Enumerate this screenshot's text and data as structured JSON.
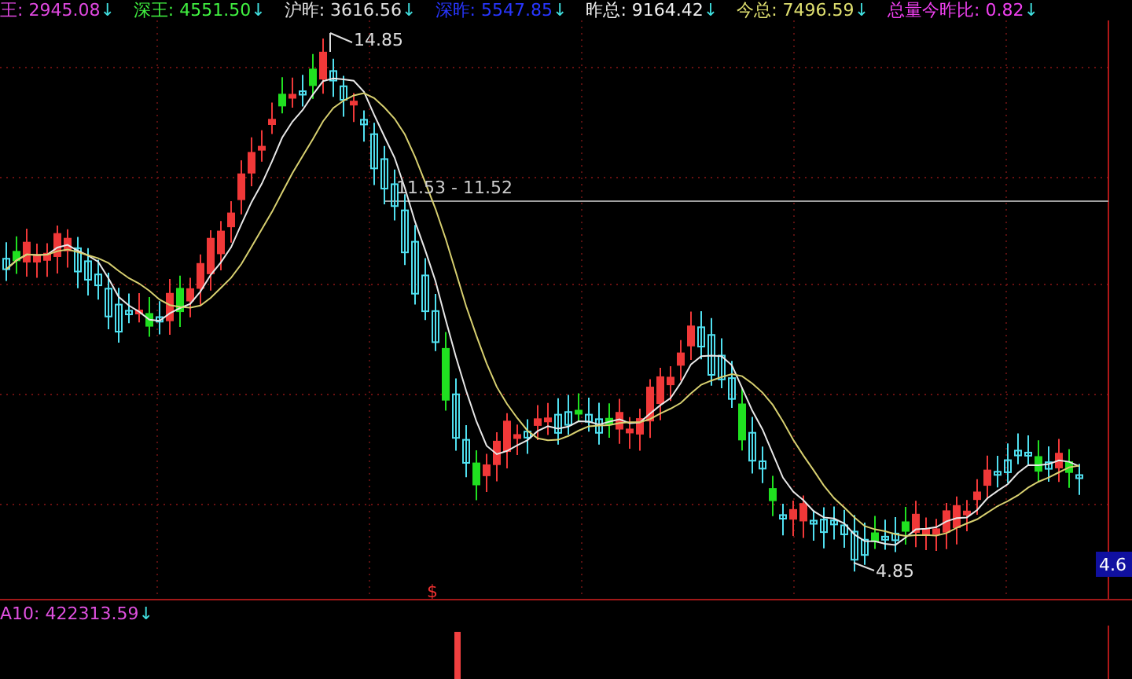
{
  "header": [
    {
      "label": "王:",
      "value": "2945.08",
      "arrow": "↓",
      "color": "#e048e0"
    },
    {
      "label": "深王:",
      "value": "4551.50",
      "arrow": "↓",
      "color": "#40f040"
    },
    {
      "label": "沪昨:",
      "value": "3616.56",
      "arrow": "↓",
      "color": "#e0e0e0"
    },
    {
      "label": "深昨:",
      "value": "5547.85",
      "arrow": "↓",
      "color": "#2836ff"
    },
    {
      "label": "昨总:",
      "value": "9164.42",
      "arrow": "↓",
      "color": "#f0f0f0"
    },
    {
      "label": "今总:",
      "value": "7496.59",
      "arrow": "↓",
      "color": "#e0e070"
    },
    {
      "label": "总量今昨比:",
      "value": "0.82",
      "arrow": "↓",
      "color": "#f040f0"
    }
  ],
  "price_chart": {
    "high_label": "14.85",
    "range_label": "11.53 - 11.52",
    "low_label": "4.85",
    "axis_label": "4.6",
    "signal_mark": "$"
  },
  "volume_pane": {
    "label": "A10:",
    "value": "422313.59",
    "arrow": "↓"
  }
}
